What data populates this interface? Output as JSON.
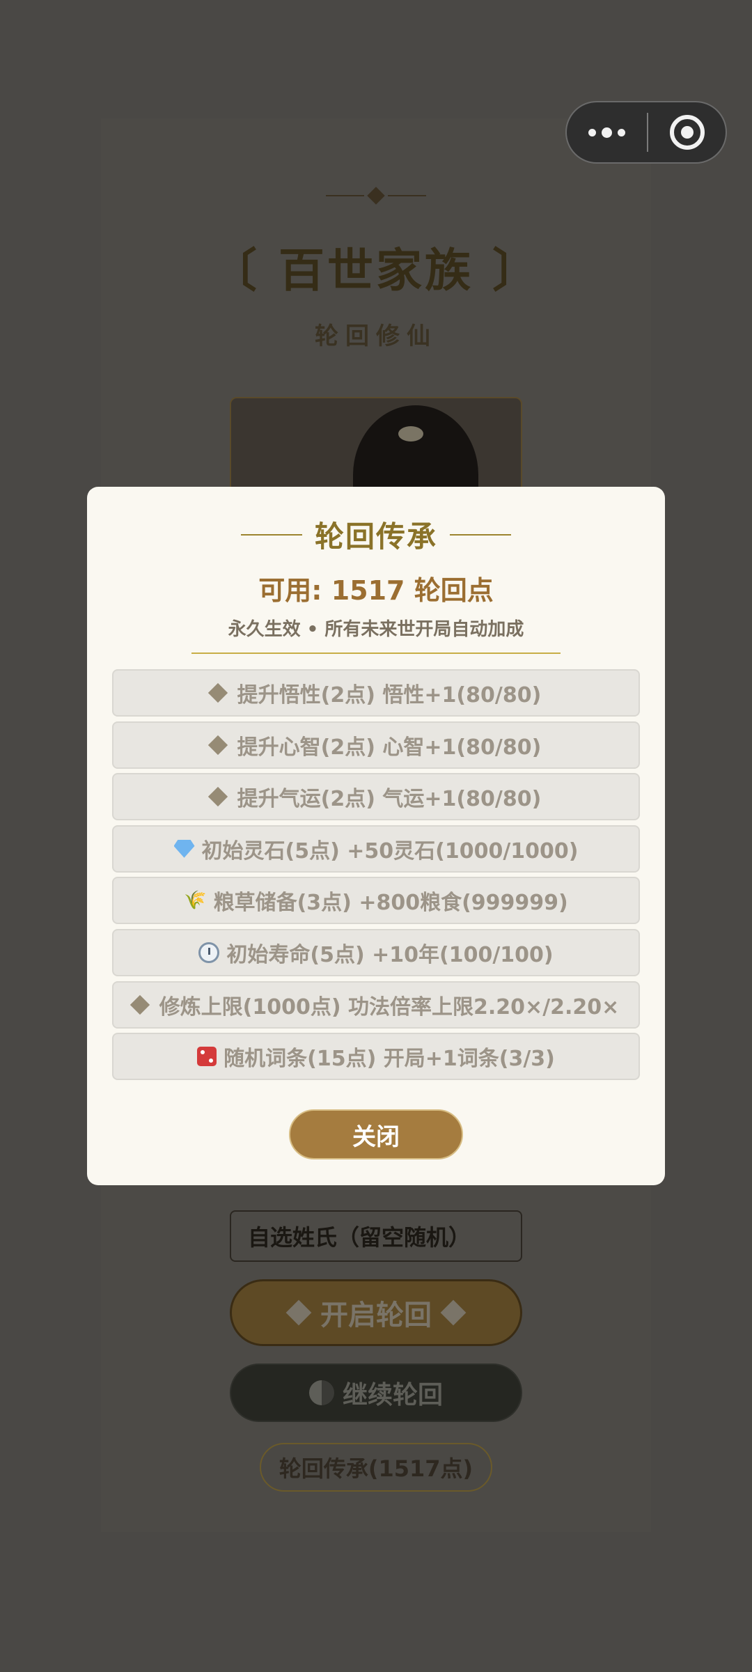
{
  "background": {
    "title": "〔 百世家族 〕",
    "subtitle": "轮回修仙",
    "surname_placeholder": "自选姓氏（留空随机）",
    "start_button": "开启轮回",
    "continue_button": "继续轮回",
    "legacy_button": "轮回传承(1517点)"
  },
  "modal": {
    "title": "轮回传承",
    "available": "可用: 1517 轮回点",
    "note": "永久生效 • 所有未来世开局自动加成",
    "options": [
      {
        "icon": "diamond-icon",
        "label": "提升悟性(2点) 悟性+1(80/80)"
      },
      {
        "icon": "diamond-icon",
        "label": "提升心智(2点) 心智+1(80/80)"
      },
      {
        "icon": "diamond-icon",
        "label": "提升气运(2点) 气运+1(80/80)"
      },
      {
        "icon": "gem-icon",
        "label": "初始灵石(5点) +50灵石(1000/1000)"
      },
      {
        "icon": "grain-icon",
        "label": "粮草储备(3点) +800粮食(999999)"
      },
      {
        "icon": "clock-icon",
        "label": "初始寿命(5点) +10年(100/100)"
      },
      {
        "icon": "diamond-icon",
        "label": "修炼上限(1000点) 功法倍率上限2.20×/2.20×"
      },
      {
        "icon": "dice-icon",
        "label": "随机词条(15点) 开局+1词条(3/3)"
      }
    ],
    "close_button": "关闭"
  },
  "colors": {
    "overlay": "#4a4845",
    "modal_bg": "#faf8f1",
    "title_gold": "#8a7228",
    "close_button": "#a57c3f"
  }
}
